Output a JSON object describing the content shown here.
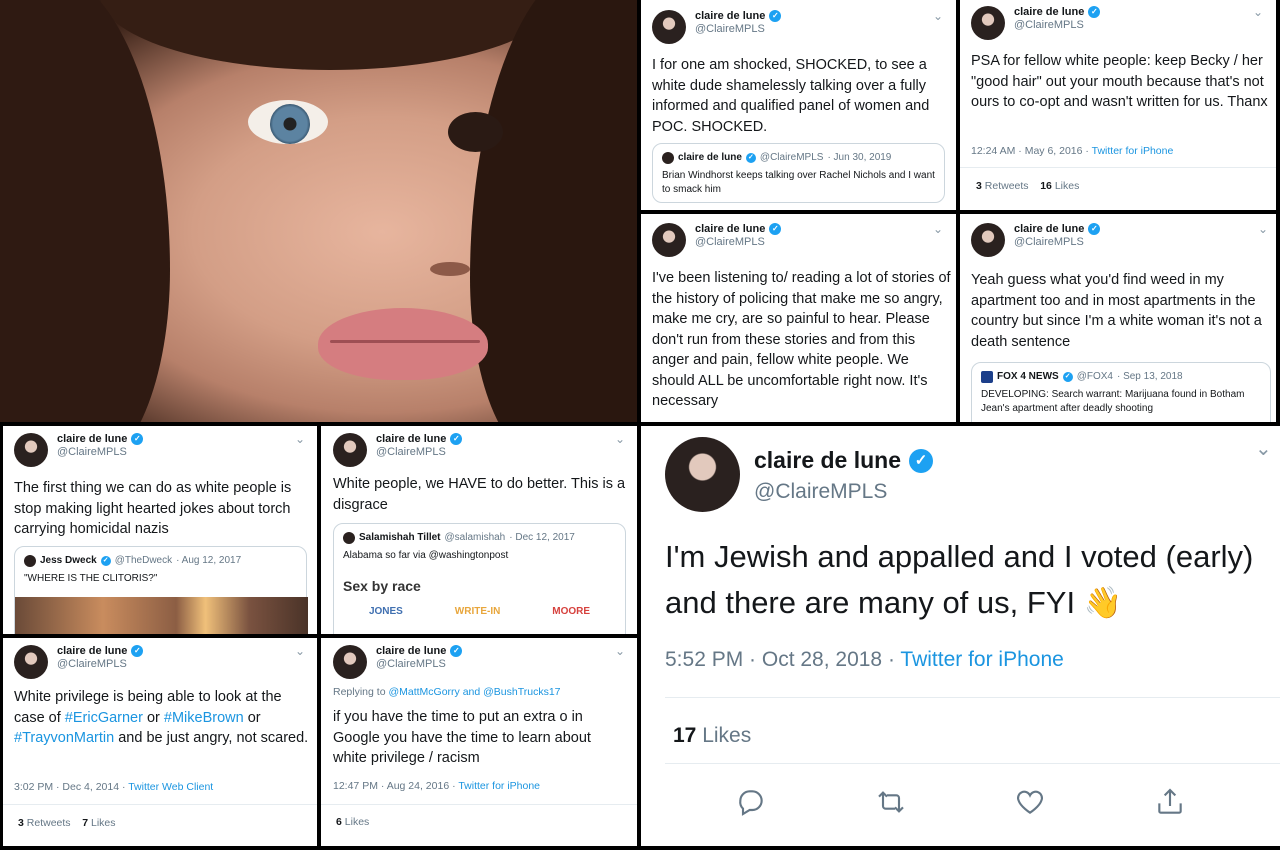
{
  "user": {
    "name": "claire de lune",
    "handle": "@ClaireMPLS"
  },
  "tweets": [
    {
      "text": "I for one am shocked, SHOCKED, to see a white dude shamelessly talking over a fully informed and qualified panel of women and POC. SHOCKED.",
      "quote": {
        "name": "claire de lune",
        "handle": "@ClaireMPLS",
        "date": "· Jun 30, 2019",
        "text": "Brian Windhorst keeps talking over Rachel Nichols and I want to smack him"
      }
    },
    {
      "text": "PSA for fellow white people: keep Becky / her \"good hair\" out your mouth because that's not ours to co-opt and wasn't written for us. Thanx",
      "time": "12:24 AM · May 6, 2016 · ",
      "source": "Twitter for iPhone",
      "retweets": "3",
      "retweets_label": "Retweets",
      "likes": "16",
      "likes_label": "Likes"
    },
    {
      "text": "I've been listening to/ reading a lot of stories of the history of policing that make me so angry, make me cry, are so painful to hear. Please don't run from these stories and from this anger and pain, fellow white people. We should ALL be uncomfortable right now. It's necessary"
    },
    {
      "text": "Yeah guess what you'd find weed in my apartment too and in most apartments in the country but since I'm a white woman it's not a death sentence",
      "quote": {
        "name": "FOX 4 NEWS",
        "handle": "@FOX4",
        "date": "· Sep 13, 2018",
        "text": "DEVELOPING: Search warrant: Marijuana found in Botham Jean's apartment after deadly shooting"
      }
    },
    {
      "text": "The first thing we can do as white people is stop making light hearted jokes about torch carrying homicidal nazis",
      "quote": {
        "name": "Jess Dweck",
        "handle": "@TheDweck",
        "date": "· Aug 12, 2017",
        "text": "\"WHERE IS THE CLITORIS?\""
      }
    },
    {
      "text": "White people, we HAVE to do better. This is a disgrace",
      "quote": {
        "name": "Salamishah Tillet",
        "handle": "@salamishah",
        "date": "· Dec 12, 2017",
        "text": "Alabama so far via @washingtonpost",
        "heading": "Sex by race",
        "cols": [
          "JONES",
          "WRITE-IN",
          "MOORE"
        ]
      }
    },
    {
      "text_before": "White privilege is being able to look at the case of ",
      "tag1": "#EricGarner",
      "or1": " or ",
      "tag2": "#MikeBrown",
      "or2": " or ",
      "tag3": "#TrayvonMartin",
      "text_after": " and be just angry, not scared.",
      "time": "3:02 PM · Dec 4, 2014 · ",
      "source": "Twitter Web Client",
      "retweets": "3",
      "retweets_label": "Retweets",
      "likes": "7",
      "likes_label": "Likes"
    },
    {
      "reply_label": "Replying to ",
      "reply_to": "@MattMcGorry and @BushTrucks17",
      "text": "if you have the time to put an extra o in Google you have the time to learn about white privilege / racism",
      "time": "12:47 PM · Aug 24, 2016 · ",
      "source": "Twitter for iPhone",
      "likes": "6",
      "likes_label": "Likes"
    }
  ],
  "feature": {
    "text": "I'm Jewish and appalled and I voted (early) and there are many of us, FYI 👋",
    "time": "5:52 PM · Oct 28, 2018 · ",
    "source": "Twitter for iPhone",
    "likes": "17",
    "likes_label": "Likes"
  },
  "colors": {
    "link": "#1b95e0",
    "verified": "#1da1f2",
    "muted": "#657786"
  }
}
